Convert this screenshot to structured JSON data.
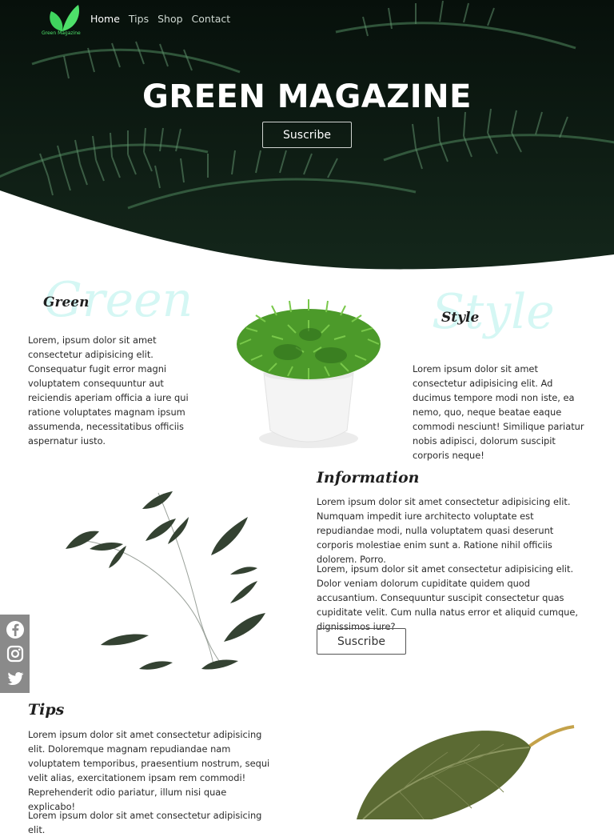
{
  "nav": {
    "logo_text": "Green Magazine",
    "links": [
      {
        "label": "Home",
        "active": true
      },
      {
        "label": "Tips",
        "active": false
      },
      {
        "label": "Shop",
        "active": false
      },
      {
        "label": "Contact",
        "active": false
      }
    ]
  },
  "hero": {
    "title": "GREEN MAGAZINE",
    "button_label": "Suscribe"
  },
  "green_section": {
    "heading": "Green",
    "ghost_word": "Green",
    "text": "Lorem, ipsum dolor sit amet consectetur adipisicing elit. Consequatur fugit error magni voluptatem consequuntur aut reiciendis aperiam officia a iure qui ratione voluptates magnam ipsum assumenda, necessitatibus officiis aspernatur iusto."
  },
  "style_section": {
    "heading": "Style",
    "ghost_word": "Style",
    "text": "Lorem ipsum dolor sit amet consectetur adipisicing elit. Ad ducimus tempore modi non iste, ea nemo, quo, neque beatae eaque commodi nesciunt! Similique pariatur nobis adipisci, dolorum suscipit corporis neque!"
  },
  "information": {
    "heading": "Information",
    "paragraph1": "Lorem ipsum dolor sit amet consectetur adipisicing elit. Numquam impedit iure architecto voluptate est repudiandae modi, nulla voluptatem quasi deserunt corporis molestiae enim sunt a. Ratione nihil officiis dolorem. Porro.",
    "paragraph2": "Lorem, ipsum dolor sit amet consectetur adipisicing elit. Dolor veniam dolorum cupiditate quidem quod accusantium. Consequuntur suscipit consectetur quas cupiditate velit. Cum nulla natus error et aliquid cumque, dignissimos iure?",
    "button_label": "Suscribe"
  },
  "tips": {
    "heading": "Tips",
    "paragraph1": "Lorem ipsum dolor sit amet consectetur adipisicing elit. Doloremque magnam repudiandae nam voluptatem temporibus, praesentium nostrum, sequi velit alias, exercitationem ipsam rem commodi! Reprehenderit odio pariatur, illum nisi quae explicabo!",
    "paragraph2": "Lorem ipsum dolor sit amet consectetur adipisicing elit."
  },
  "social": {
    "icons": [
      "facebook-icon",
      "instagram-icon",
      "twitter-icon"
    ]
  },
  "colors": {
    "accent_green": "#4ee06a",
    "ghost_text": "#d5f7f4",
    "social_bar": "#8a8a8a",
    "hero_dark": "#0d1a12"
  }
}
